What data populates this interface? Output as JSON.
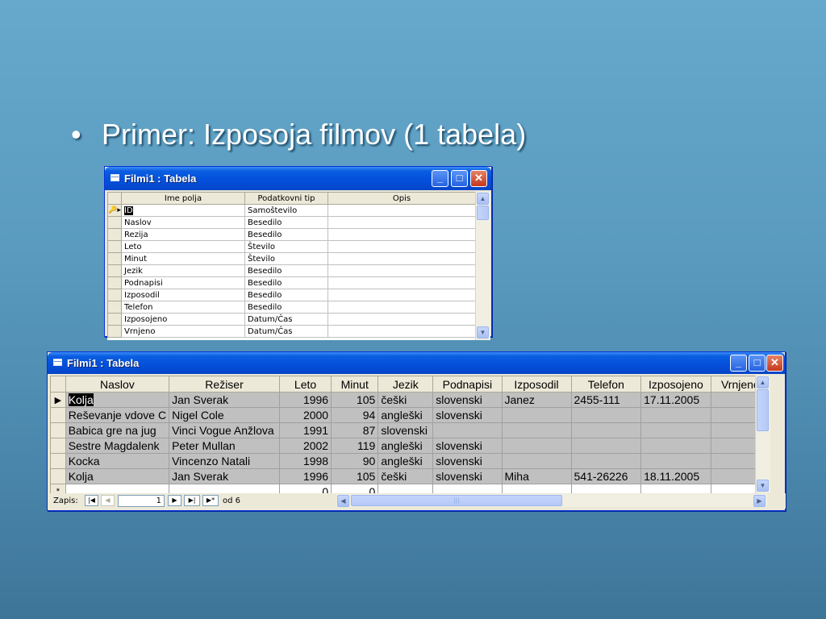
{
  "slide": {
    "bullet": "•",
    "title": "Primer: Izposoja filmov (1 tabela)"
  },
  "design_window": {
    "title": "Filmi1 : Tabela",
    "headers": [
      "Ime polja",
      "Podatkovni tip",
      "Opis"
    ],
    "key_marker": "🔑▸",
    "rows": [
      {
        "name": "ID",
        "type": "Samoštevilo",
        "desc": ""
      },
      {
        "name": "Naslov",
        "type": "Besedilo",
        "desc": ""
      },
      {
        "name": "Rezija",
        "type": "Besedilo",
        "desc": ""
      },
      {
        "name": "Leto",
        "type": "Število",
        "desc": ""
      },
      {
        "name": "Minut",
        "type": "Število",
        "desc": ""
      },
      {
        "name": "Jezik",
        "type": "Besedilo",
        "desc": ""
      },
      {
        "name": "Podnapisi",
        "type": "Besedilo",
        "desc": ""
      },
      {
        "name": "Izposodil",
        "type": "Besedilo",
        "desc": ""
      },
      {
        "name": "Telefon",
        "type": "Besedilo",
        "desc": ""
      },
      {
        "name": "Izposojeno",
        "type": "Datum/Čas",
        "desc": ""
      },
      {
        "name": "Vrnjeno",
        "type": "Datum/Čas",
        "desc": ""
      }
    ]
  },
  "datasheet_window": {
    "title": "Filmi1 : Tabela",
    "headers": [
      "Naslov",
      "Režiser",
      "Leto",
      "Minut",
      "Jezik",
      "Podnapisi",
      "Izposodil",
      "Telefon",
      "Izposojeno",
      "Vrnjeno"
    ],
    "current_marker": "▶",
    "new_marker": "*",
    "rows": [
      [
        "Kolja",
        "Jan Sverak",
        "1996",
        "105",
        "češki",
        "slovenski",
        "Janez",
        "2455-111",
        "17.11.2005",
        ""
      ],
      [
        "Reševanje vdove C",
        "Nigel Cole",
        "2000",
        "94",
        "angleški",
        "slovenski",
        "",
        "",
        "",
        ""
      ],
      [
        "Babica gre na jug",
        "Vinci Vogue Anžlova",
        "1991",
        "87",
        "slovenski",
        "",
        "",
        "",
        "",
        ""
      ],
      [
        "Sestre Magdalenk",
        "Peter Mullan",
        "2002",
        "119",
        "angleški",
        "slovenski",
        "",
        "",
        "",
        ""
      ],
      [
        "Kocka",
        "Vincenzo Natali",
        "1998",
        "90",
        "angleški",
        "slovenski",
        "",
        "",
        "",
        ""
      ],
      [
        "Kolja",
        "Jan Sverak",
        "1996",
        "105",
        "češki",
        "slovenski",
        "Miha",
        "541-26226",
        "18.11.2005",
        ""
      ]
    ],
    "new_row": [
      "",
      "",
      "0",
      "0",
      "",
      "",
      "",
      "",
      "",
      ""
    ],
    "nav": {
      "label": "Zapis:",
      "first": "|◀",
      "prev": "◀",
      "record": "1",
      "next": "▶",
      "last": "▶|",
      "new": "▶*",
      "of": "od 6"
    }
  },
  "window_buttons": {
    "minimize": "_",
    "maximize": "□",
    "close": "✕"
  },
  "colors": {
    "background_top": "#66a9cc",
    "background_bottom": "#3d7598",
    "titlebar": "#0450dc",
    "window_face": "#ece9d8"
  }
}
